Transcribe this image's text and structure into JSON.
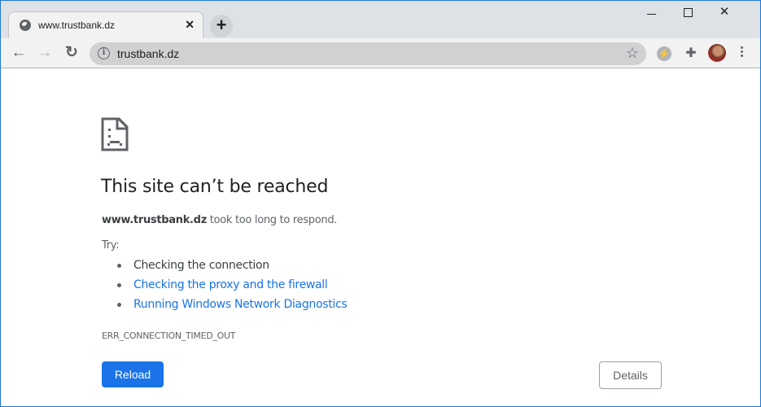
{
  "browser": {
    "tab": {
      "title": "www.trustbank.dz",
      "close_label": "✕",
      "favicon": "globe-icon"
    },
    "new_tab_label": "+",
    "window_controls": {
      "close_label": "✕"
    },
    "nav": {
      "back": "←",
      "forward": "→",
      "reload": "↻"
    },
    "omnibox": {
      "url": "trustbank.dz",
      "info_glyph": "i",
      "star_glyph": "☆"
    },
    "extensions": {
      "bolt_glyph": "⚡",
      "puzzle_glyph": "✚"
    }
  },
  "error_page": {
    "title": "This site can’t be reached",
    "host": "www.trustbank.dz",
    "summary_rest": " took too long to respond.",
    "try_label": "Try:",
    "suggestions": [
      {
        "text": "Checking the connection",
        "link": false
      },
      {
        "text": "Checking the proxy and the firewall",
        "link": true
      },
      {
        "text": "Running Windows Network Diagnostics",
        "link": true
      }
    ],
    "error_code": "ERR_CONNECTION_TIMED_OUT",
    "reload_label": "Reload",
    "details_label": "Details"
  },
  "colors": {
    "accent": "#1a73e8",
    "window_border": "#1e78d6"
  }
}
